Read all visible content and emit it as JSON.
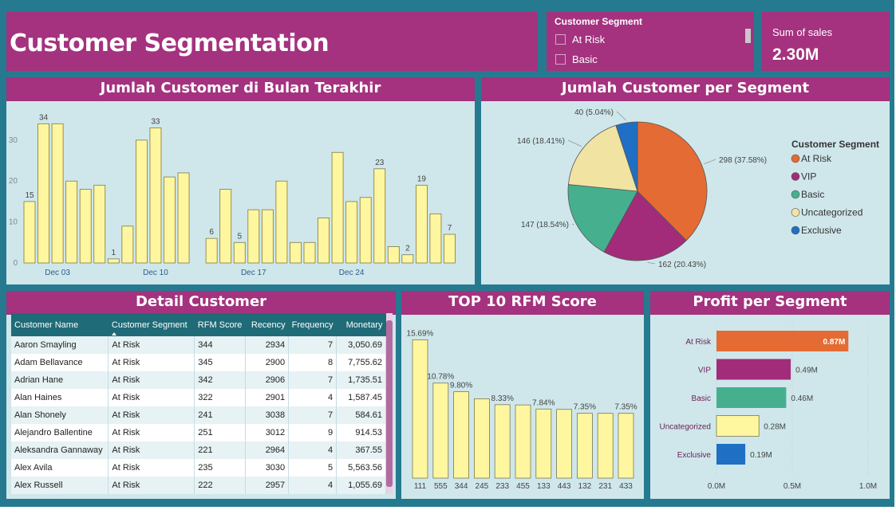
{
  "title": "Customer Segmentation",
  "slicer": {
    "title": "Customer Segment",
    "items": [
      "At Risk",
      "Basic"
    ]
  },
  "kpi": {
    "label": "Sum of sales",
    "value": "2.30M"
  },
  "colors": {
    "at_risk": "#e46b33",
    "vip": "#a22c7a",
    "basic": "#46b08e",
    "uncategorized": "#f1e3a2",
    "exclusive": "#1f6fc4",
    "bar_yellow": "#fff6a0",
    "header": "#a4327f",
    "panel": "#cfe7eb",
    "frame": "#257a90"
  },
  "chart_data": [
    {
      "id": "daily",
      "type": "bar",
      "title": "Jumlah Customer di Bulan Terakhir",
      "values": [
        15,
        34,
        34,
        20,
        18,
        19,
        1,
        9,
        30,
        33,
        21,
        22,
        null,
        6,
        18,
        5,
        13,
        13,
        20,
        5,
        5,
        11,
        27,
        15,
        16,
        23,
        4,
        2,
        19,
        12,
        7
      ],
      "data_labels": {
        "0": "15",
        "1": "34",
        "6": "1",
        "9": "33",
        "13": "6",
        "15": "5",
        "25": "23",
        "27": "2",
        "28": "19",
        "30": "7"
      },
      "x_ticks": [
        {
          "i": 2,
          "label": "Dec 03"
        },
        {
          "i": 9,
          "label": "Dec 10"
        },
        {
          "i": 16,
          "label": "Dec 17"
        },
        {
          "i": 23,
          "label": "Dec 24"
        }
      ],
      "y_ticks": [
        0,
        10,
        20,
        30
      ],
      "ylim": [
        0,
        36
      ]
    },
    {
      "id": "segments",
      "type": "pie",
      "title": "Jumlah Customer per Segment",
      "legend_title": "Customer Segment",
      "slices": [
        {
          "name": "At Risk",
          "value": 298,
          "label": "298 (37.58%)",
          "color": "#e46b33"
        },
        {
          "name": "VIP",
          "value": 162,
          "label": "162 (20.43%)",
          "color": "#a22c7a"
        },
        {
          "name": "Basic",
          "value": 147,
          "label": "147 (18.54%)",
          "color": "#46b08e"
        },
        {
          "name": "Uncategorized",
          "value": 146,
          "label": "146 (18.41%)",
          "color": "#f1e3a2"
        },
        {
          "name": "Exclusive",
          "value": 40,
          "label": "40 (5.04%)",
          "color": "#1f6fc4"
        }
      ]
    },
    {
      "id": "rfm",
      "type": "bar",
      "title": "TOP 10 RFM Score",
      "categories": [
        "111",
        "555",
        "344",
        "245",
        "233",
        "455",
        "133",
        "443",
        "132",
        "231",
        "433"
      ],
      "values": [
        15.69,
        10.78,
        9.8,
        9.0,
        8.33,
        8.3,
        7.84,
        7.8,
        7.35,
        7.35,
        7.35
      ],
      "data_labels": {
        "0": "15.69%",
        "1": "10.78%",
        "2": "9.80%",
        "4": "8.33%",
        "6": "7.84%",
        "8": "7.35%",
        "10": "7.35%"
      },
      "ylim": [
        0,
        16
      ]
    },
    {
      "id": "profit",
      "type": "bar",
      "title": "Profit per Segment",
      "categories": [
        "At Risk",
        "VIP",
        "Basic",
        "Uncategorized",
        "Exclusive"
      ],
      "values": [
        0.87,
        0.49,
        0.46,
        0.28,
        0.19
      ],
      "value_labels": [
        "0.87M",
        "0.49M",
        "0.46M",
        "0.28M",
        "0.19M"
      ],
      "colors": [
        "#e46b33",
        "#a22c7a",
        "#46b08e",
        "#fff6a0",
        "#1f6fc4"
      ],
      "x_ticks": [
        "0.0M",
        "0.5M",
        "1.0M"
      ],
      "xlim": [
        0,
        1.0
      ]
    }
  ],
  "table": {
    "title": "Detail Customer",
    "columns": [
      "Customer Name",
      "Customer Segment",
      "RFM Score",
      "Recency",
      "Frequency",
      "Monetary"
    ],
    "sort_icon": "sort-ascending-icon",
    "rows": [
      [
        "Aaron Smayling",
        "At Risk",
        "344",
        "2934",
        "7",
        "3,050.69"
      ],
      [
        "Adam Bellavance",
        "At Risk",
        "345",
        "2900",
        "8",
        "7,755.62"
      ],
      [
        "Adrian Hane",
        "At Risk",
        "342",
        "2906",
        "7",
        "1,735.51"
      ],
      [
        "Alan Haines",
        "At Risk",
        "322",
        "2901",
        "4",
        "1,587.45"
      ],
      [
        "Alan Shonely",
        "At Risk",
        "241",
        "3038",
        "7",
        "584.61"
      ],
      [
        "Alejandro Ballentine",
        "At Risk",
        "251",
        "3012",
        "9",
        "914.53"
      ],
      [
        "Aleksandra Gannaway",
        "At Risk",
        "221",
        "2964",
        "4",
        "367.55"
      ],
      [
        "Alex Avila",
        "At Risk",
        "235",
        "3030",
        "5",
        "5,563.56"
      ],
      [
        "Alex Russell",
        "At Risk",
        "222",
        "2957",
        "4",
        "1,055.69"
      ]
    ]
  }
}
